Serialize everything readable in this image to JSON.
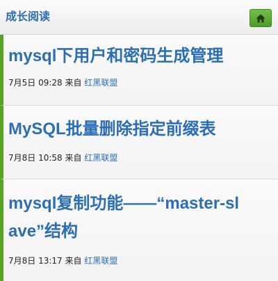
{
  "header": {
    "title": "成长阅读",
    "home_icon": "home-icon",
    "home_color": "#58a224"
  },
  "articles": [
    {
      "title": "mysql下用户和密码生成管理",
      "date": "7月5日 09:28",
      "from_label": "来自",
      "source": "红黑联盟"
    },
    {
      "title": "MySQL批量删除指定前缀表",
      "date": "7月8日 10:58",
      "from_label": "来自",
      "source": "红黑联盟"
    },
    {
      "title": "mysql复制功能——“master-slave”结构",
      "date": "7月8日 13:17",
      "from_label": "来自",
      "source": "红黑联盟"
    }
  ],
  "colors": {
    "accent": "#2b6eb6",
    "item_border": "#58a224"
  }
}
